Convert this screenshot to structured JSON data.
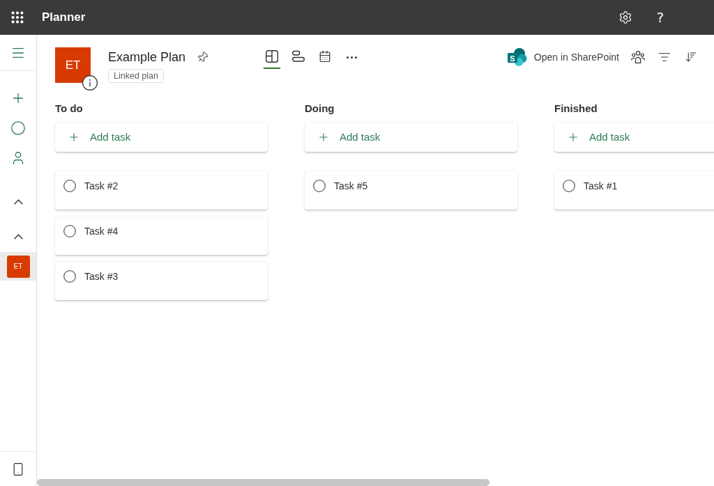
{
  "app_bar": {
    "title": "Planner",
    "help": "?"
  },
  "nav_rail": {
    "plans": [
      {
        "initials": "ET",
        "selected": true
      }
    ]
  },
  "plan": {
    "initials": "ET",
    "title": "Example Plan",
    "tag": "Linked plan"
  },
  "view_tabs": [
    {
      "kind": "board",
      "selected": true
    },
    {
      "kind": "schedule",
      "selected": false
    },
    {
      "kind": "calendar",
      "selected": false
    }
  ],
  "sharepoint": {
    "logo_letter": "S",
    "label": "Open in SharePoint"
  },
  "buckets": [
    {
      "name": "To do",
      "add_label": "Add task",
      "tasks": [
        {
          "title": "Task #2",
          "completed": false
        },
        {
          "title": "Task #4",
          "completed": false
        },
        {
          "title": "Task #3",
          "completed": false
        }
      ]
    },
    {
      "name": "Doing",
      "add_label": "Add task",
      "tasks": [
        {
          "title": "Task #5",
          "completed": false
        }
      ]
    },
    {
      "name": "Finished",
      "add_label": "Add task",
      "tasks": [
        {
          "title": "Task #1",
          "completed": false
        }
      ]
    }
  ]
}
